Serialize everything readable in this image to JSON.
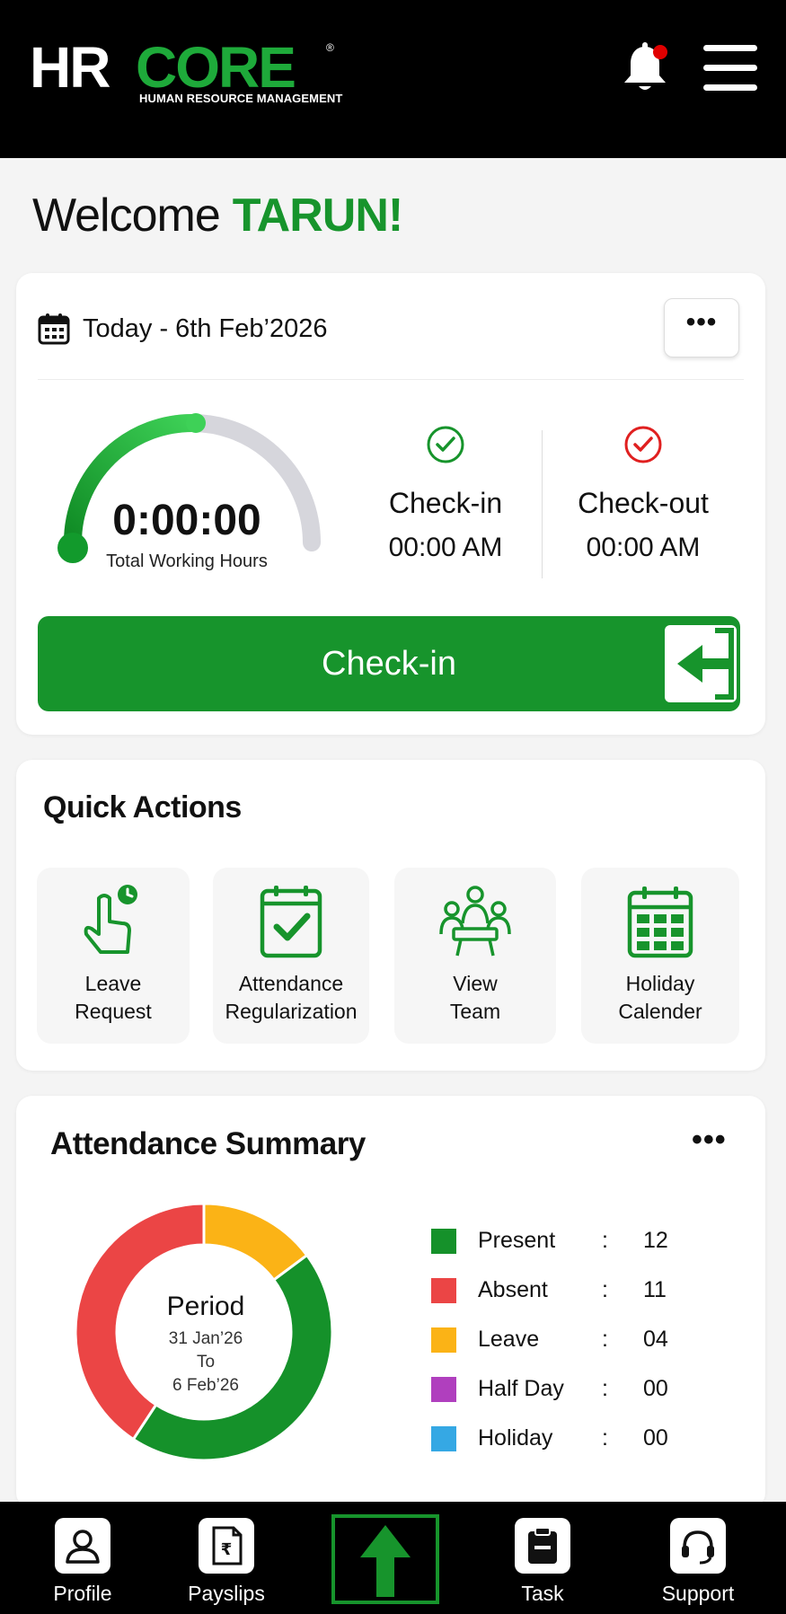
{
  "header": {
    "logo_hr": "HR",
    "logo_core": "CORE",
    "logo_registered": "®",
    "logo_subtitle": "HUMAN RESOURCE MANAGEMENT",
    "notification_dot_color": "#e10000"
  },
  "welcome": {
    "greeting": "Welcome",
    "name": "TARUN!"
  },
  "today": {
    "date_text": "Today - 6th Feb’2026",
    "more_label": "•••",
    "working_hours": "0:00:00",
    "working_hours_label": "Total Working Hours",
    "checkin_label": "Check-in",
    "checkin_time": "00:00 AM",
    "checkout_label": "Check-out",
    "checkout_time": "00:00 AM",
    "checkin_button": "Check-in"
  },
  "quick_actions": {
    "title": "Quick Actions",
    "items": [
      {
        "line1": "Leave",
        "line2": "Request",
        "icon": "leave-request-icon"
      },
      {
        "line1": "Attendance",
        "line2": "Regularization",
        "icon": "attendance-regularization-icon"
      },
      {
        "line1": "View",
        "line2": "Team",
        "icon": "team-icon"
      },
      {
        "line1": "Holiday",
        "line2": "Calender",
        "icon": "holiday-calendar-icon"
      }
    ]
  },
  "attendance": {
    "title": "Attendance Summary",
    "more_label": "•••",
    "period_title": "Period",
    "period_from": "31 Jan’26",
    "period_to_word": "To",
    "period_to": "6 Feb’26",
    "legend": [
      {
        "name": "Present",
        "sep": ":",
        "value": "12",
        "color": "#15912a"
      },
      {
        "name": "Absent",
        "sep": ":",
        "value": "11",
        "color": "#eb4545"
      },
      {
        "name": "Leave",
        "sep": ":",
        "value": "04",
        "color": "#fbb316"
      },
      {
        "name": "Half Day",
        "sep": ":",
        "value": "00",
        "color": "#b03fbe"
      },
      {
        "name": "Holiday",
        "sep": ":",
        "value": "00",
        "color": "#35a8e4"
      }
    ]
  },
  "nav": {
    "profile": "Profile",
    "payslips": "Payslips",
    "task": "Task",
    "support": "Support"
  },
  "colors": {
    "brand_green": "#17942c",
    "header_bg": "#000000"
  }
}
